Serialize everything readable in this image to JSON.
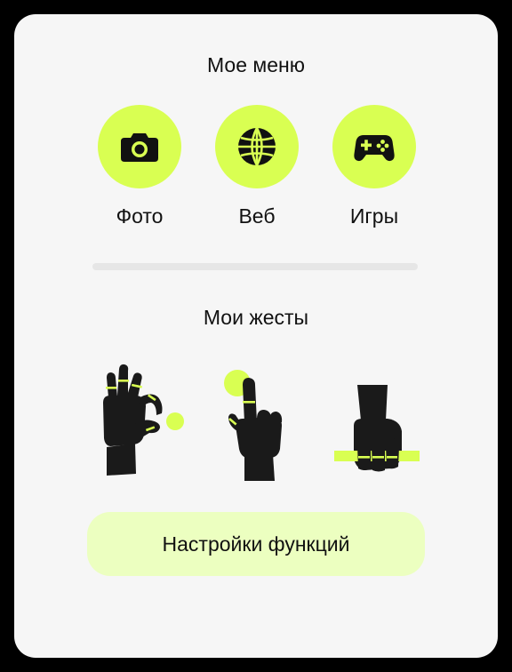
{
  "menu": {
    "title": "Мое меню",
    "items": [
      {
        "label": "Фото",
        "icon": "camera-icon"
      },
      {
        "label": "Веб",
        "icon": "globe-icon"
      },
      {
        "label": "Игры",
        "icon": "gamepad-icon"
      }
    ]
  },
  "gestures": {
    "title": "Мои жесты",
    "items": [
      {
        "icon": "pinch-gesture-icon"
      },
      {
        "icon": "tap-gesture-icon"
      },
      {
        "icon": "grab-gesture-icon"
      }
    ]
  },
  "settings_button": {
    "label": "Настройки функций"
  },
  "colors": {
    "accent": "#d9ff52",
    "accent_light": "#ecffc0",
    "card_background": "#f6f6f6",
    "icon": "#1a1a1a"
  }
}
